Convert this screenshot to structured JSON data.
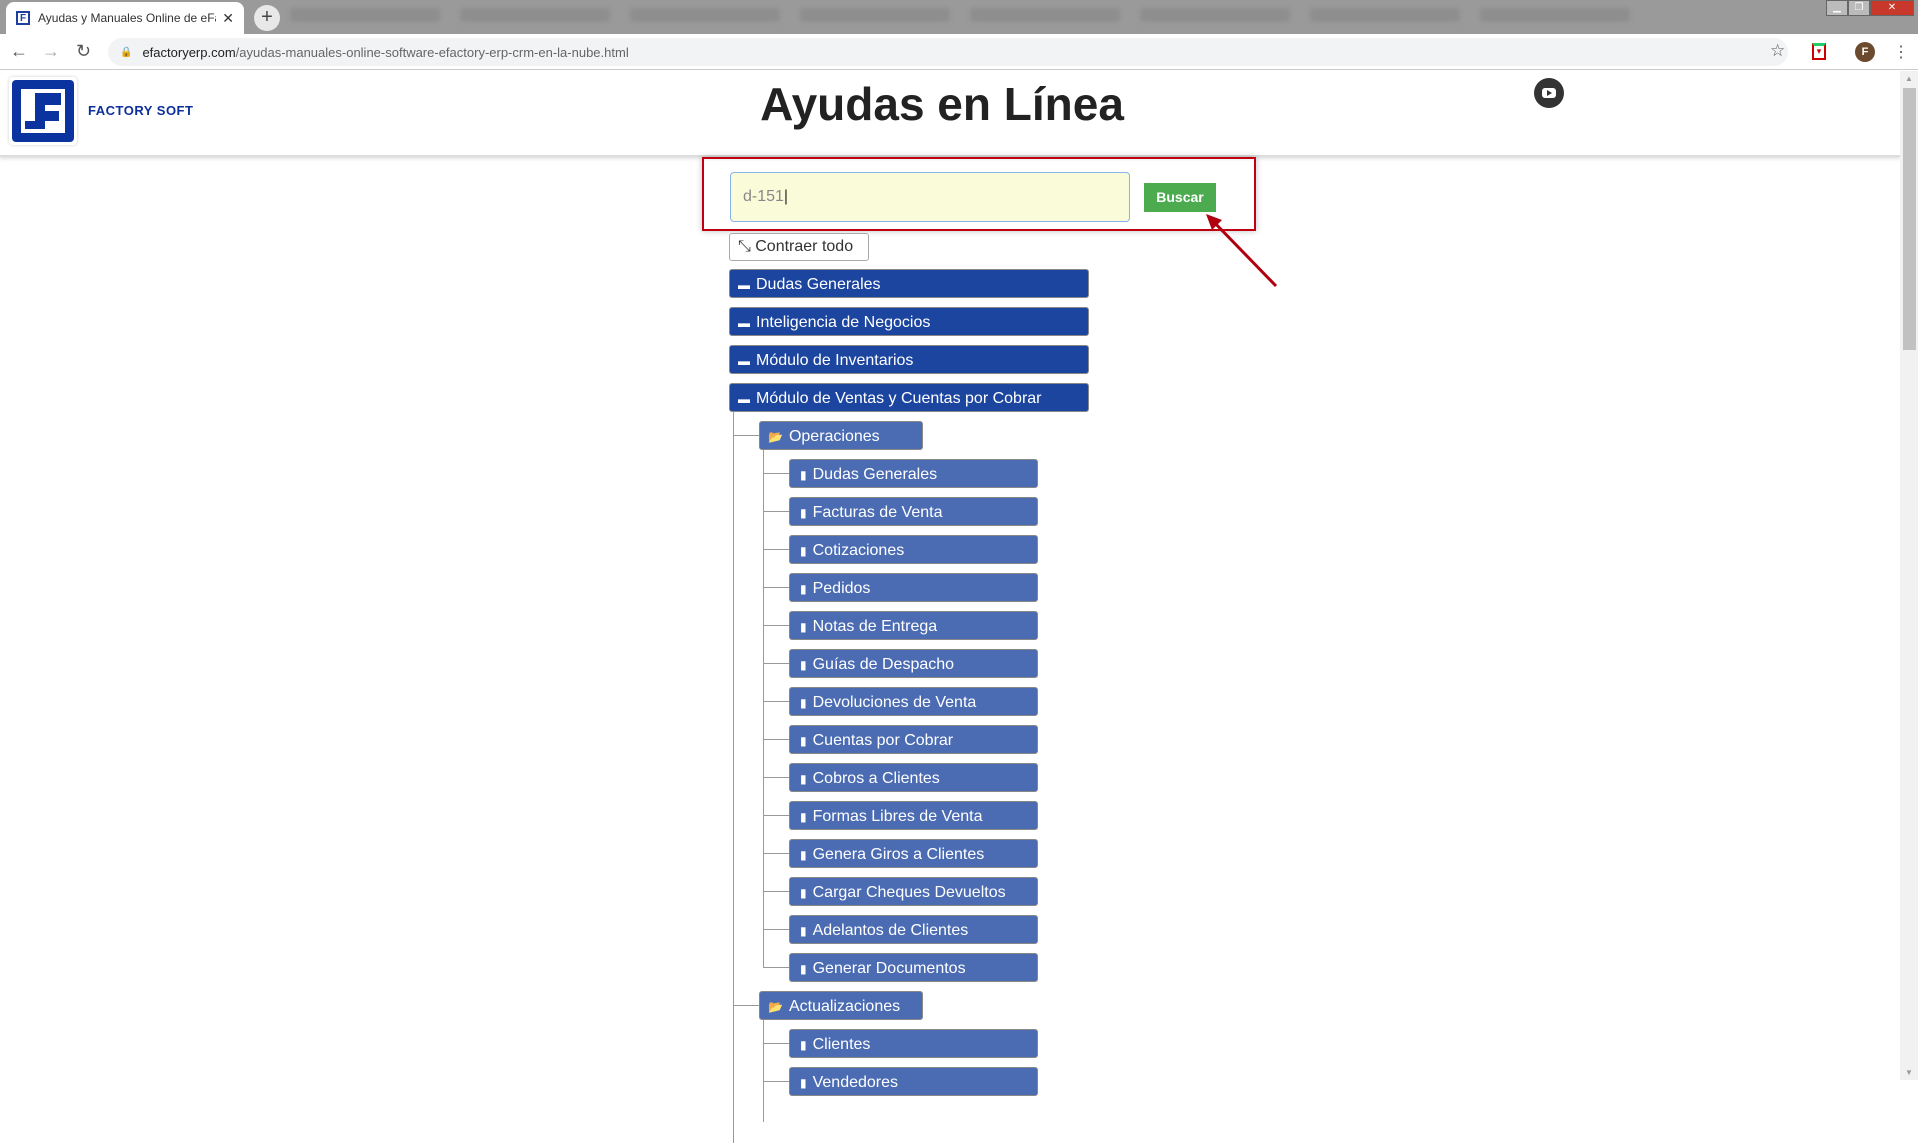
{
  "browser": {
    "tab_title": "Ayudas y Manuales Online de eFactory",
    "url_host": "efactoryerp.com",
    "url_path": "/ayudas-manuales-online-software-efactory-erp-crm-en-la-nube.html"
  },
  "header": {
    "brand": "FACTORY SOFT",
    "title": "Ayudas en Línea"
  },
  "search": {
    "value": "d-151",
    "button": "Buscar"
  },
  "contraer": "Contraer todo",
  "tree": {
    "top": [
      "Dudas Generales",
      "Inteligencia de Negocios",
      "Módulo de Inventarios",
      "Módulo de Ventas y Cuentas por Cobrar"
    ],
    "groups": [
      {
        "label": "Operaciones",
        "items": [
          "Dudas Generales",
          "Facturas de Venta",
          "Cotizaciones",
          "Pedidos",
          "Notas de Entrega",
          "Guías de Despacho",
          "Devoluciones de Venta",
          "Cuentas por Cobrar",
          "Cobros a Clientes",
          "Formas Libres de Venta",
          "Genera Giros a Clientes",
          "Cargar Cheques Devueltos",
          "Adelantos de Clientes",
          "Generar Documentos"
        ]
      },
      {
        "label": "Actualizaciones",
        "items": [
          "Clientes",
          "Vendedores"
        ]
      }
    ]
  },
  "colors": {
    "top_item": "#1c45a0",
    "sub_item": "#4b6cb3",
    "buscar": "#4caa4f",
    "highlight": "#c00010"
  }
}
